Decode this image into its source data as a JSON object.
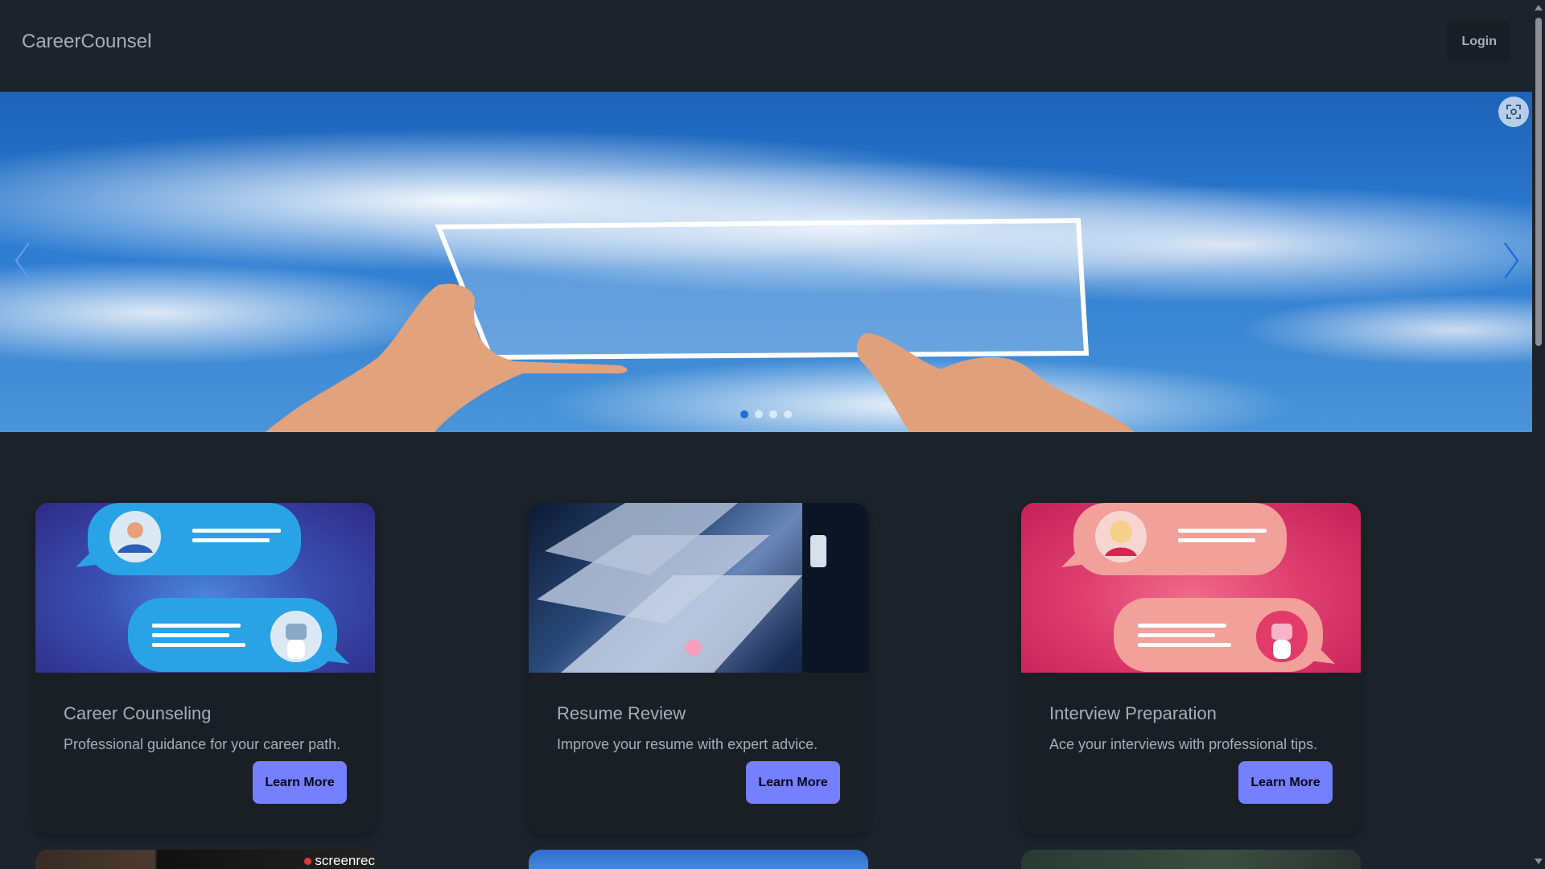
{
  "nav": {
    "brand": "CareerCounsel",
    "login_label": "Login"
  },
  "hero": {
    "slide_count": 4,
    "active_slide": 1
  },
  "cards": [
    {
      "title": "Career Counseling",
      "text": "Professional guidance for your career path.",
      "button_label": "Learn More"
    },
    {
      "title": "Resume Review",
      "text": "Improve your resume with expert advice.",
      "button_label": "Learn More"
    },
    {
      "title": "Interview Preparation",
      "text": "Ace your interviews with professional tips.",
      "button_label": "Learn More"
    }
  ],
  "watermark": {
    "text": "screenrec"
  },
  "colors": {
    "background": "#1d232a",
    "primary": "#7480ff",
    "card": "#1a1f26",
    "active_dot": "#1e6fd6"
  }
}
